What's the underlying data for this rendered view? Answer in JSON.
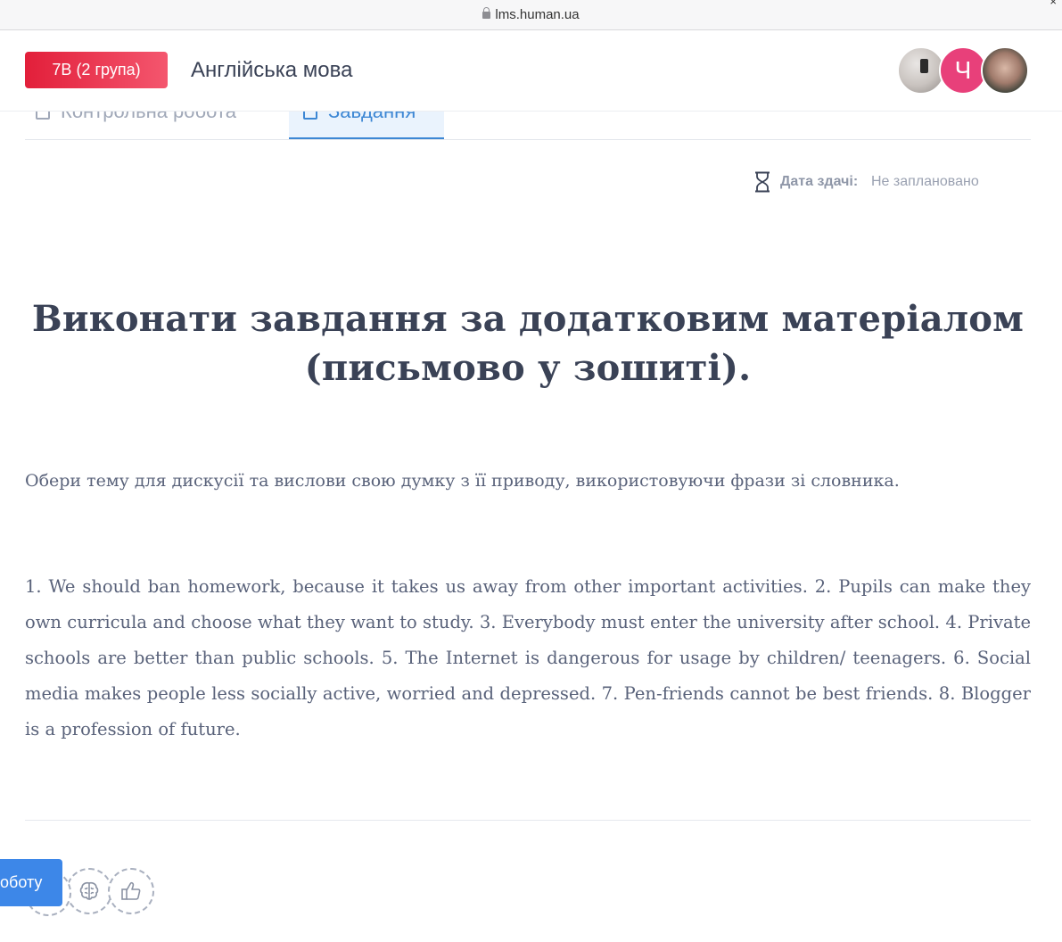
{
  "browser": {
    "url": "lms.human.ua"
  },
  "header": {
    "group": "7В (2 група)",
    "subject": "Англійська мова",
    "avatars": [
      {
        "name": "user-photo-1"
      },
      {
        "initial": "Ч",
        "color": "#e8407a"
      },
      {
        "name": "user-photo-2"
      }
    ]
  },
  "tabs": [
    {
      "label": "Контрольна робота",
      "active": false
    },
    {
      "label": "Завдання",
      "active": true
    }
  ],
  "due": {
    "label": "Дата здачі:",
    "value": "Не заплановано"
  },
  "task": {
    "title": "Виконати завдання за додатковим матеріалом (письмово у зошиті).",
    "intro": "Обери тему для дискусії та вислови свою думку з її приводу, використовуючи фрази зі словника.",
    "body": "1. We should ban homework, because it takes us away from other important activities. 2. Pupils can make they own curricula and choose what they want to study. 3. Everybody must enter the university after school. 4. Private schools are better than public schools. 5. The Internet is dangerous for usage by children/ teenagers. 6. Social media makes people less socially active, worried and depressed. 7. Pen-friends cannot be best friends. 8. Blogger is a profession of future."
  },
  "actions": {
    "submit_label": "роботу"
  },
  "colors": {
    "accent": "#3d87e8",
    "badge": "#e21f3a",
    "text": "#3a4256"
  }
}
